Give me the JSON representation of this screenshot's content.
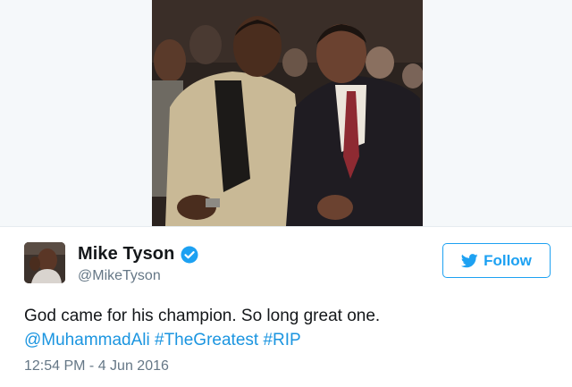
{
  "tweet": {
    "author": {
      "display_name": "Mike Tyson",
      "handle": "@MikeTyson",
      "verified": true
    },
    "follow_button": {
      "label": "Follow",
      "icon": "twitter-bird-icon"
    },
    "text": {
      "line1": "God came for his champion. So long great one.",
      "mention": "@MuhammadAli",
      "hashtag1": "#TheGreatest",
      "hashtag2": "#RIP"
    },
    "timestamp": "12:54 PM - 4 Jun 2016",
    "colors": {
      "accent": "#1da1f2",
      "link": "#1b95e0",
      "text": "#14171a",
      "secondary": "#657786",
      "media_background": "#f5f8fa"
    }
  }
}
